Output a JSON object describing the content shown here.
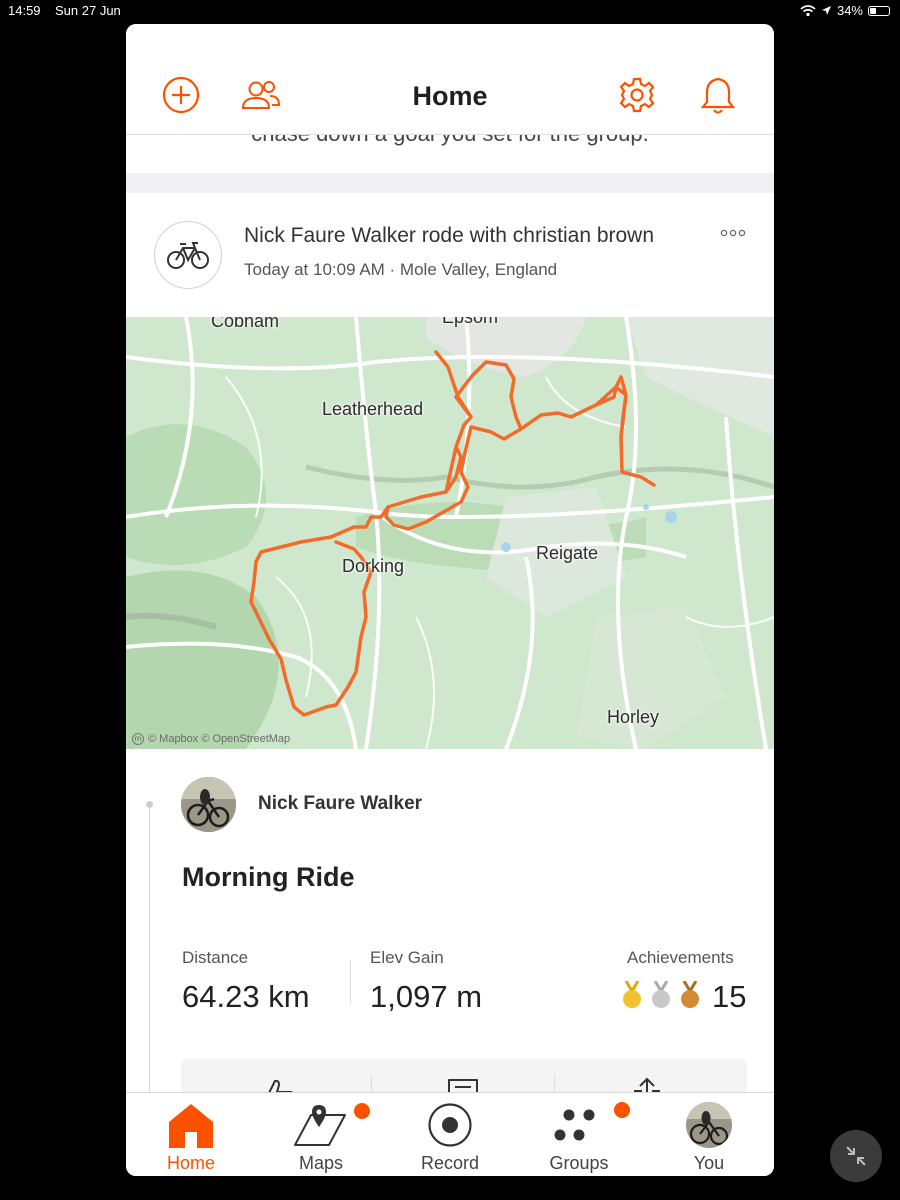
{
  "status_bar": {
    "time": "14:59",
    "date": "Sun 27 Jun",
    "battery": "34%"
  },
  "header": {
    "title": "Home",
    "icons": [
      "add-circle-icon",
      "people-icon",
      "gear-icon",
      "bell-icon"
    ]
  },
  "peek_text": "chase down a goal you set for the group.",
  "activity": {
    "title": "Nick Faure Walker rode with christian brown",
    "subtitle": "Today at 10:09 AM · Mole Valley, England",
    "type_icon": "bicycle-icon",
    "athlete_name": "Nick Faure Walker",
    "ride_name": "Morning Ride",
    "stats": [
      {
        "label": "Distance",
        "value": "64.23 km"
      },
      {
        "label": "Elev Gain",
        "value": "1,097 m"
      }
    ],
    "achievements": {
      "label": "Achievements",
      "count": "15",
      "medals": [
        "gold",
        "silver",
        "bronze"
      ]
    }
  },
  "map": {
    "labels": [
      "Cobham",
      "Epsom",
      "Leatherhead",
      "Dorking",
      "Reigate",
      "Horley"
    ],
    "attribution": "© Mapbox © OpenStreetMap",
    "route_color": "#f26b2b"
  },
  "actions": [
    "kudos-thumb-icon",
    "comment-icon",
    "share-icon"
  ],
  "tabs": [
    {
      "label": "Home",
      "icon": "home-icon",
      "active": true,
      "badge": false
    },
    {
      "label": "Maps",
      "icon": "maps-icon",
      "active": false,
      "badge": true
    },
    {
      "label": "Record",
      "icon": "record-icon",
      "active": false,
      "badge": false
    },
    {
      "label": "Groups",
      "icon": "groups-icon",
      "active": false,
      "badge": true
    },
    {
      "label": "You",
      "icon": "profile-avatar-icon",
      "active": false,
      "badge": false
    }
  ],
  "colors": {
    "accent": "#fc5200",
    "map_green": "#cfe7cd",
    "gold": "#f2c12e",
    "silver": "#c8c8c8",
    "bronze": "#d28a35"
  }
}
